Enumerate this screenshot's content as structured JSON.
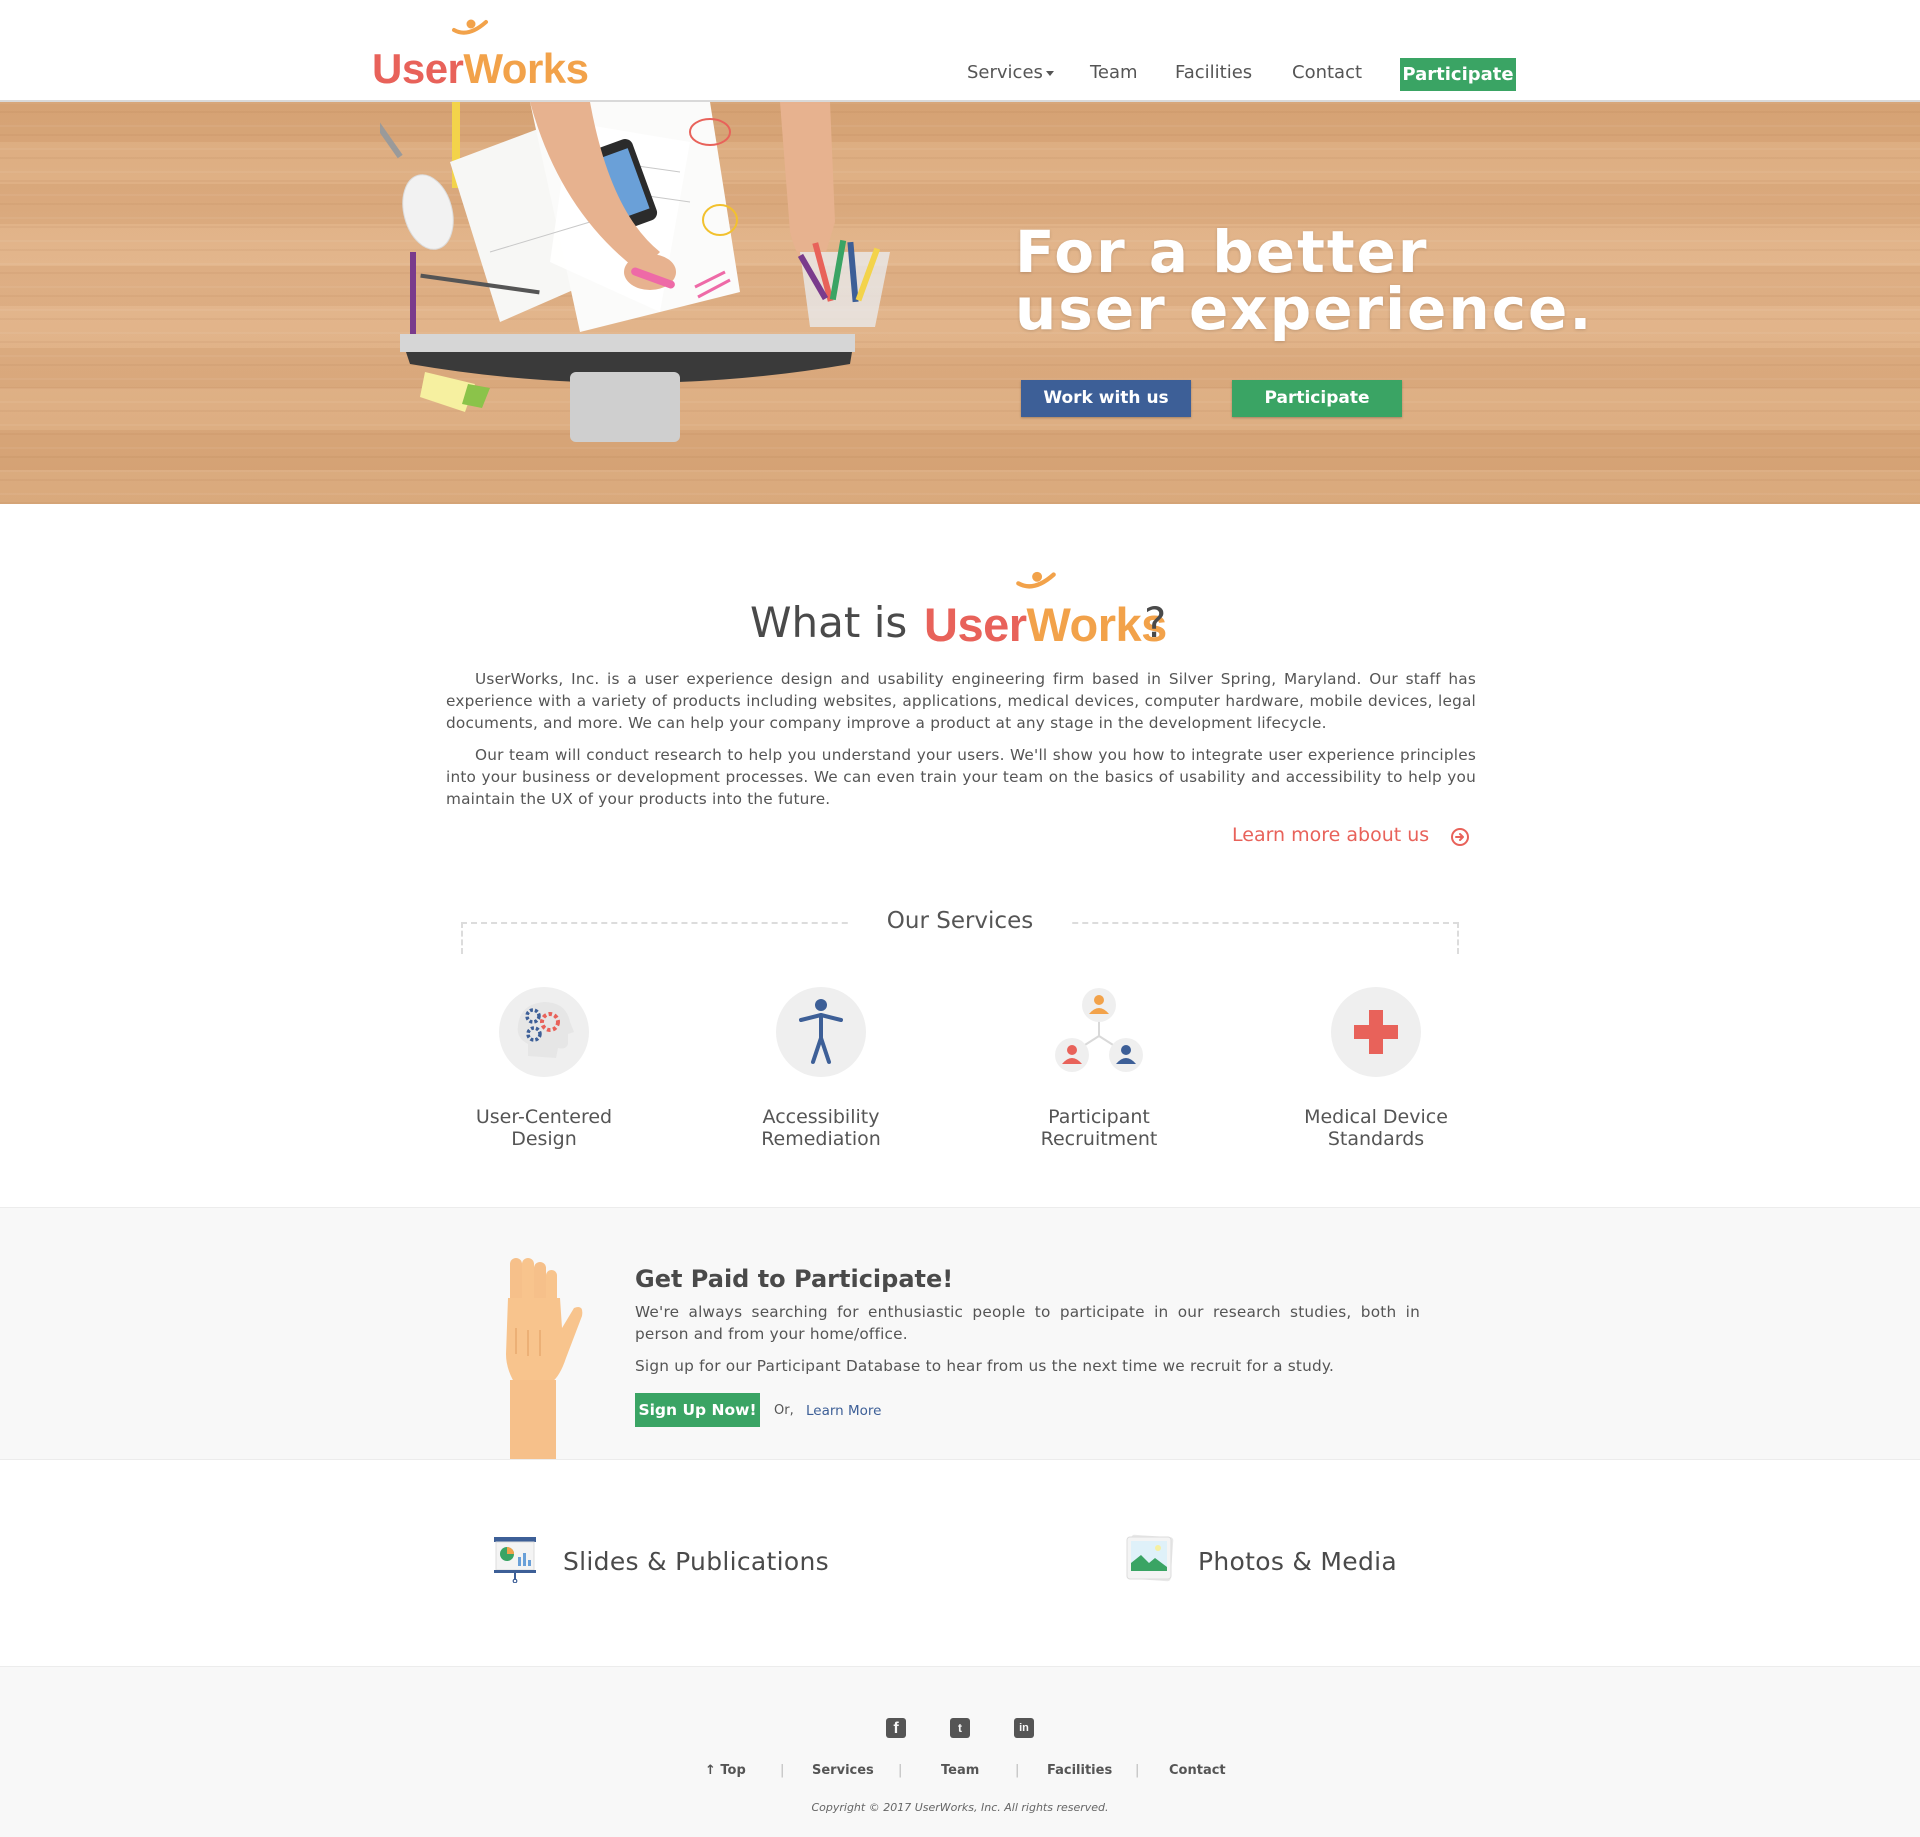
{
  "brand": {
    "logo_user": "User",
    "logo_w": "W",
    "logo_orks": "orks",
    "colors": {
      "red": "#e8625a",
      "orange": "#f2a24a",
      "green": "#3aa464",
      "blue": "#3d5f97"
    }
  },
  "nav": {
    "services": "Services",
    "team": "Team",
    "facilities": "Facilities",
    "contact": "Contact",
    "participate": "Participate"
  },
  "hero": {
    "title_line1": "For a better",
    "title_line2": "user experience.",
    "work_button": "Work with us",
    "participate_button": "Participate"
  },
  "about": {
    "title_prefix": "What is",
    "title_suffix": "?",
    "paragraph1": "UserWorks, Inc. is a user experience design and usability engineering firm based in Silver Spring, Maryland. Our staff has experience with a variety of products including websites, applications, medical devices, computer hardware, mobile devices, legal documents, and more. We can help your company improve a product at any stage in the development lifecycle.",
    "paragraph2": "Our team will conduct research to help you understand your users. We'll show you how to integrate user experience principles into your business or development processes. We can even train your team on the basics of usability and accessibility to help you maintain the UX of your products into the future.",
    "learn_more": "Learn more about us"
  },
  "services": {
    "title": "Our Services",
    "items": [
      {
        "line1": "User-Centered",
        "line2": "Design",
        "icon": "head-gears-icon"
      },
      {
        "line1": "Accessibility",
        "line2": "Remediation",
        "icon": "accessibility-person-icon"
      },
      {
        "line1": "Participant",
        "line2": "Recruitment",
        "icon": "participants-network-icon"
      },
      {
        "line1": "Medical Device",
        "line2": "Standards",
        "icon": "medical-cross-icon"
      }
    ]
  },
  "participate": {
    "title": "Get Paid to Participate!",
    "text1": "We're always searching for enthusiastic people to participate in our research studies, both in person and from your home/office.",
    "text2": "Sign up for our Participant Database to hear from us the next time we recruit for a study.",
    "signup_button": "Sign Up Now!",
    "or": "Or,",
    "learn_more": "Learn More"
  },
  "resources": {
    "slides": "Slides & Publications",
    "photos": "Photos & Media"
  },
  "footer": {
    "social": [
      "facebook-icon",
      "twitter-icon",
      "linkedin-icon"
    ],
    "links": {
      "top": "↑ Top",
      "services": "Services",
      "team": "Team",
      "facilities": "Facilities",
      "contact": "Contact"
    },
    "separator": "|",
    "copyright": "Copyright © 2017 UserWorks, Inc. All rights reserved."
  }
}
